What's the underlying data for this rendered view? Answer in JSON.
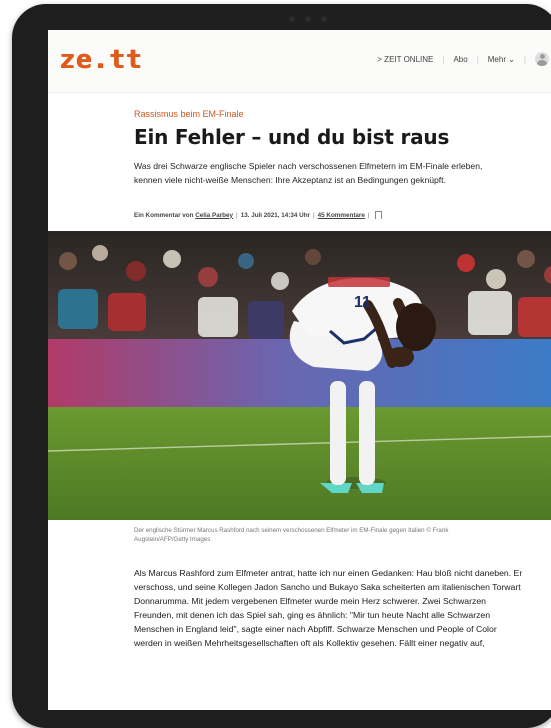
{
  "site": {
    "logo": "ze.tt",
    "nav": {
      "zeit_online": "> ZEIT ONLINE",
      "abo": "Abo",
      "mehr": "Mehr ⌄"
    }
  },
  "article": {
    "kicker": "Rassismus beim EM-Finale",
    "title": "Ein Fehler – und du bist raus",
    "lead": "Was drei Schwarze englische Spieler nach verschossenen Elfmetern im EM-Finale erleben, kennen viele nicht-weiße Menschen: Ihre Akzeptanz ist an Bedingungen geknüpft.",
    "byline": {
      "prefix": "Ein Kommentar von",
      "author": "Celia Parbey",
      "date": "13. Juli 2021, 14:34 Uhr",
      "comments": "45 Kommentare",
      "separator": "|"
    },
    "image_caption": "Der englische Stürmer Marcus Rashford nach seinem verschossenen Elfmeter im EM-Finale gegen Italien © Frank Augstein/AFP/Getty Images",
    "player_shirt_number": "11",
    "body": "Als Marcus Rashford zum Elfmeter antrat, hatte ich nur einen Gedanken: Hau bloß nicht daneben. Er verschoss, und seine Kollegen Jadon Sancho und Bukayo Saka scheiterten am italienischen Torwart Donnarumma. Mit jedem vergebenen Elfmeter wurde mein Herz schwerer. Zwei Schwarzen Freunden, mit denen ich das Spiel sah, ging es ähnlich: \"Mir tun heute Nacht alle Schwarzen Menschen in England leid\", sagte einer nach Abpfiff. Schwarze Menschen und People of Color werden in weißen Mehrheitsgesellschaften oft als Kollektiv gesehen. Fällt einer negativ auf,"
  },
  "colors": {
    "accent": "#e05a1a",
    "kicker": "#d2551c",
    "device_frame": "#1e1e1e",
    "pitch": "#5f8a2c"
  },
  "icons": [
    "user-avatar-icon",
    "bookmark-icon",
    "chevron-down-icon"
  ]
}
